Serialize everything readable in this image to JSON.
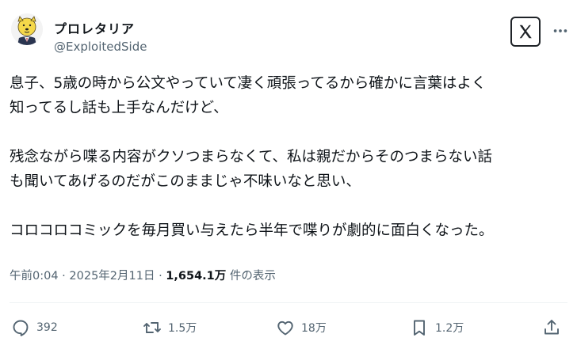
{
  "author": {
    "display_name": "プロレタリア",
    "handle": "@ExploitedSide"
  },
  "tweet": {
    "text": "息子、5歳の時から公文やっていて凄く頑張ってるから確かに言葉はよく\n知ってるし話も上手なんだけど、\n\n残念ながら喋る内容がクソつまらなくて、私は親だからそのつまらない話\nも聞いてあげるのだがこのままじゃ不味いなと思い、\n\nコロコロコミックを毎月買い与えたら半年で喋りが劇的に面白くなった。"
  },
  "meta": {
    "time": "午前0:04",
    "separator1": " · ",
    "date": "2025年2月11日",
    "separator2": " · ",
    "views_count": "1,654.1万",
    "views_label": " 件の表示"
  },
  "actions": {
    "replies": "392",
    "reposts": "1.5万",
    "likes": "18万",
    "bookmarks": "1.2万"
  },
  "icons": {
    "avatar": "cartoon-dog-avatar",
    "brand": "x-logo-icon",
    "reply": "reply-icon",
    "repost": "repost-icon",
    "like": "heart-icon",
    "bookmark": "bookmark-icon",
    "share": "share-icon"
  },
  "colors": {
    "text": "#0f1419",
    "secondary": "#536471",
    "avatar_dog": "#f5d84a"
  }
}
